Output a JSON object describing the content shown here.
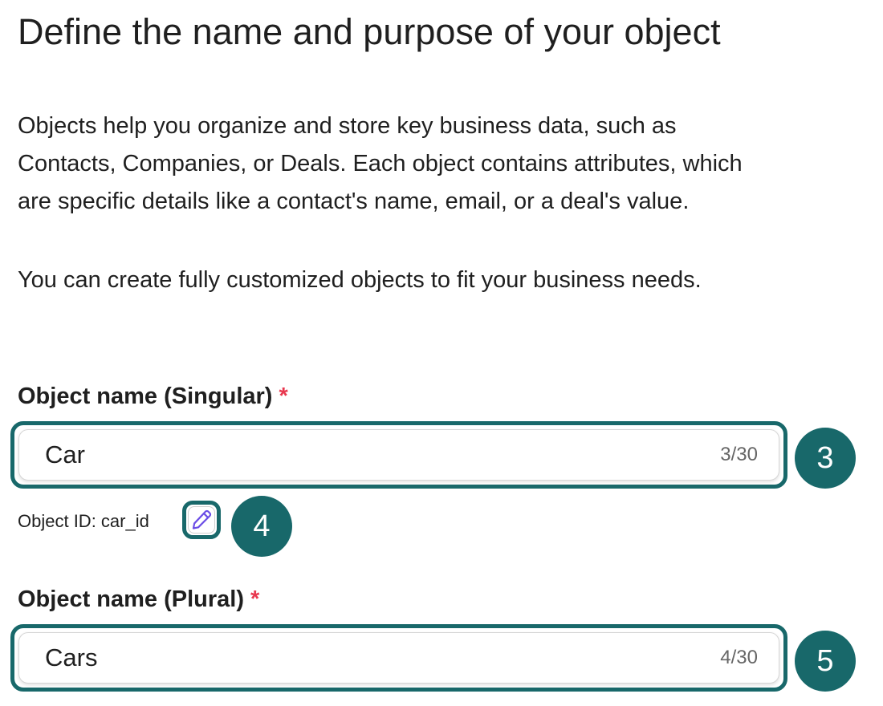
{
  "header": {
    "title": "Define the name and purpose of your object"
  },
  "description": {
    "paragraph1_lines": [
      "Objects help you organize and store key business data, such as",
      "Contacts, Companies, or Deals. Each object contains attributes, which",
      "are specific details like a contact's name, email, or a deal's value."
    ],
    "paragraph2": "You can create fully customized objects to fit your business needs."
  },
  "form": {
    "singular": {
      "label": "Object name (Singular)",
      "required_mark": "*",
      "value": "Car",
      "counter": "3/30"
    },
    "object_id": {
      "text": "Object ID: car_id",
      "edit_icon": "pencil-icon"
    },
    "plural": {
      "label": "Object name (Plural)",
      "required_mark": "*",
      "value": "Cars",
      "counter": "4/30"
    }
  },
  "annotations": {
    "step_3": "3",
    "step_4": "4",
    "step_5": "5"
  },
  "colors": {
    "highlight": "#18686a",
    "required": "#e8384f",
    "edit_icon": "#6c4ee6",
    "text": "#1f1f1f"
  }
}
